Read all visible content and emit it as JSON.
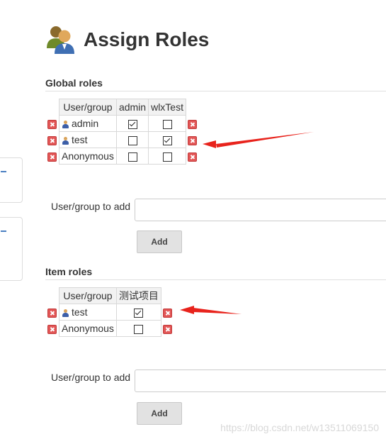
{
  "page": {
    "title": "Assign Roles",
    "title_icon": "users-icon"
  },
  "global_roles": {
    "heading": "Global roles",
    "columns": [
      "User/group",
      "admin",
      "wlxTest"
    ],
    "rows": [
      {
        "name": "admin",
        "is_user": true,
        "checks": [
          true,
          false
        ]
      },
      {
        "name": "test",
        "is_user": true,
        "checks": [
          false,
          true
        ]
      },
      {
        "name": "Anonymous",
        "is_user": false,
        "checks": [
          false,
          false
        ]
      }
    ],
    "add_label": "User/group to add",
    "add_value": "",
    "add_button": "Add"
  },
  "item_roles": {
    "heading": "Item roles",
    "columns": [
      "User/group",
      "测试项目"
    ],
    "rows": [
      {
        "name": "test",
        "is_user": true,
        "checks": [
          true
        ]
      },
      {
        "name": "Anonymous",
        "is_user": false,
        "checks": [
          false
        ]
      }
    ],
    "add_label": "User/group to add",
    "add_value": "",
    "add_button": "Add"
  },
  "annotation_color": "#e8231c",
  "watermark": "https://blog.csdn.net/w13511069150"
}
